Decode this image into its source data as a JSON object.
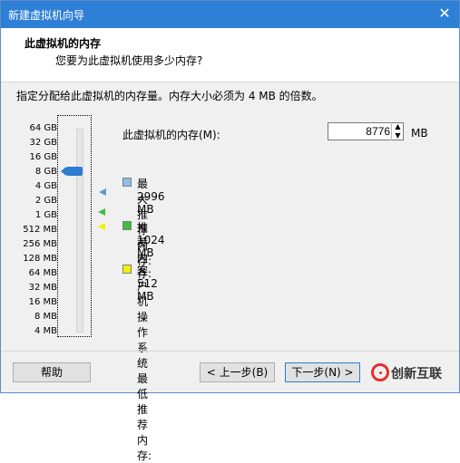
{
  "window": {
    "title": "新建虚拟机向导"
  },
  "header": {
    "title": "此虚拟机的内存",
    "subtitle": "您要为此虚拟机使用多少内存?"
  },
  "instructions": "指定分配给此虚拟机的内存量。内存大小必须为 4 MB 的倍数。",
  "scale": {
    "labels": [
      "64 GB",
      "32 GB",
      "16 GB",
      "8 GB",
      "4 GB",
      "2 GB",
      "1 GB",
      "512 MB",
      "256 MB",
      "128 MB",
      "64 MB",
      "32 MB",
      "16 MB",
      "8 MB",
      "4 MB"
    ],
    "thumb_value": "8 GB"
  },
  "memory": {
    "label": "此虚拟机的内存(M):",
    "value": "8776",
    "unit": "MB"
  },
  "legend": {
    "max": {
      "title": "最大推荐内存:",
      "value": "2996 MB"
    },
    "recommended": {
      "title": "推荐内存:",
      "value": "1024 MB"
    },
    "guest_min": {
      "title": "客户机操作系统最低推荐内存:",
      "value": "512 MB"
    }
  },
  "buttons": {
    "help": "帮助",
    "back": "< 上一步(B)",
    "next": "下一步(N) >"
  },
  "watermark": {
    "text": "创新互联"
  },
  "colors": {
    "titlebar": "#2e7fd6",
    "thumb": "#2d7bd2",
    "marker_max": "#5b9ad1",
    "marker_rec": "#3cbf3c",
    "marker_min": "#f2f000",
    "watermark_logo": "#e4302f"
  },
  "icons": {
    "close": "close-icon",
    "spin_up": "spin-up-icon",
    "spin_down": "spin-down-icon",
    "logo": "watermark-logo"
  }
}
